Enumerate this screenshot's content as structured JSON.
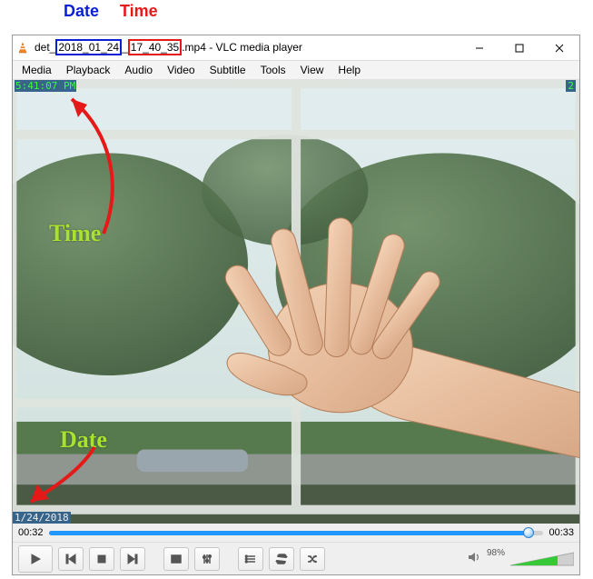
{
  "annotations": {
    "top_date_label": "Date",
    "top_time_label": "Time",
    "overlay_time_label": "Time",
    "overlay_date_label": "Date"
  },
  "title": {
    "prefix": "det_",
    "date_part": "2018_01_24",
    "sep": "_",
    "time_part": "17_40_35",
    "suffix": ".mp4 - VLC media player"
  },
  "menubar": {
    "items": [
      "Media",
      "Playback",
      "Audio",
      "Video",
      "Subtitle",
      "Tools",
      "View",
      "Help"
    ]
  },
  "overlay": {
    "time": "5:41:07 PM",
    "counter": "2",
    "date": "1/24/2018"
  },
  "seek": {
    "elapsed": "00:32",
    "total": "00:33"
  },
  "volume": {
    "percent_label": "98%"
  }
}
